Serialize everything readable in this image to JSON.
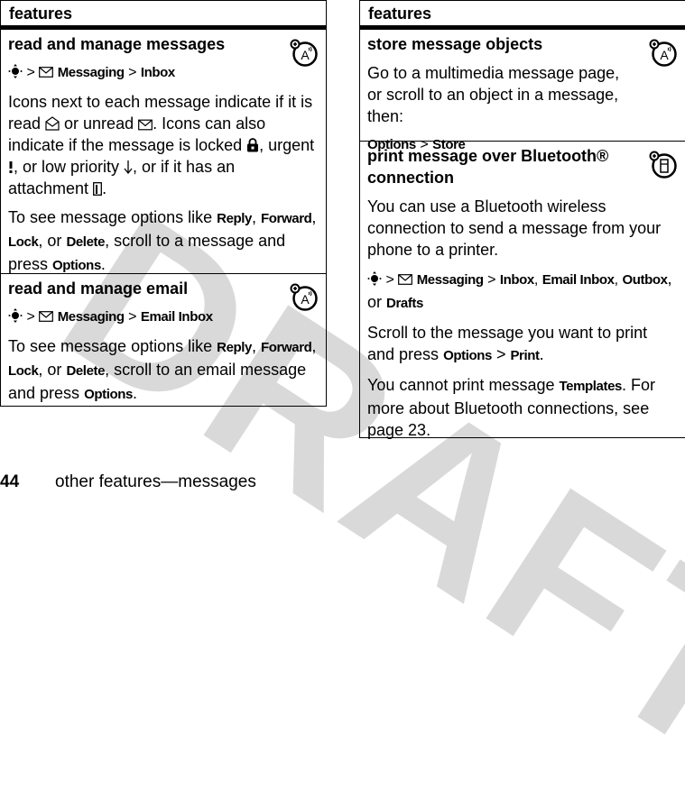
{
  "watermark": "DRAFT",
  "left_table": {
    "header": "features",
    "rows": [
      {
        "title": "read and manage messages",
        "icon": "network-feature-icon",
        "path": {
          "sep": ">",
          "menu": "Messaging",
          "sep2": ">",
          "item": "Inbox"
        },
        "para1": {
          "t1": "Icons next to each message indicate if it is read ",
          "t2": " or unread ",
          "t3": ". Icons can also indicate if the message is locked ",
          "t4": ", urgent ",
          "t5": ", or low priority ",
          "t6": ", or if it has an attachment ",
          "t7": "."
        },
        "para2": {
          "t1": "To see message options like ",
          "reply": "Reply",
          "c1": ", ",
          "forward": "Forward",
          "c2": ", ",
          "lock": "Lock",
          "t2": ", or ",
          "delete": "Delete",
          "t3": ", scroll to a message and press ",
          "options": "Options",
          "t4": "."
        }
      },
      {
        "title": "read and manage email",
        "icon": "network-feature-icon",
        "path": {
          "sep": ">",
          "menu": "Messaging",
          "sep2": ">",
          "item": "Email Inbox"
        },
        "para1": {
          "t1": "To see message options like ",
          "reply": "Reply",
          "c1": ", ",
          "forward": "Forward",
          "c2": ", ",
          "lock": "Lock",
          "t2": ", or ",
          "delete": "Delete",
          "t3": ", scroll to an email message and press ",
          "options": "Options",
          "t4": "."
        }
      }
    ]
  },
  "right_table": {
    "header": "features",
    "rows": [
      {
        "title": "store message objects",
        "icon": "network-feature-icon",
        "para1": "Go to a multimedia message page, or scroll to an object in a message, then:",
        "path": {
          "options": "Options",
          "sep": ">",
          "store": "Store"
        }
      },
      {
        "title": "print message over Bluetooth® connection",
        "icon": "phone-feature-icon",
        "para1": "You can use a Bluetooth wireless connection to send a message from your phone to a printer.",
        "path": {
          "sep": ">",
          "menu": "Messaging",
          "sep2": ">",
          "inbox": "Inbox",
          "c1": ", ",
          "email_inbox": "Email Inbox",
          "c2": ", ",
          "outbox": "Outbox",
          "or": ", or ",
          "drafts": "Drafts"
        },
        "para2": {
          "t1": "Scroll to the message you want to print and press ",
          "options": "Options",
          "sep": " > ",
          "print": "Print",
          "t2": "."
        },
        "para3": {
          "t1": "You cannot print message ",
          "templates": "Templates",
          "t2": ". For more about Bluetooth connections, see page 23."
        }
      }
    ]
  },
  "footer": {
    "page_number": "44",
    "section": "other features—messages"
  }
}
